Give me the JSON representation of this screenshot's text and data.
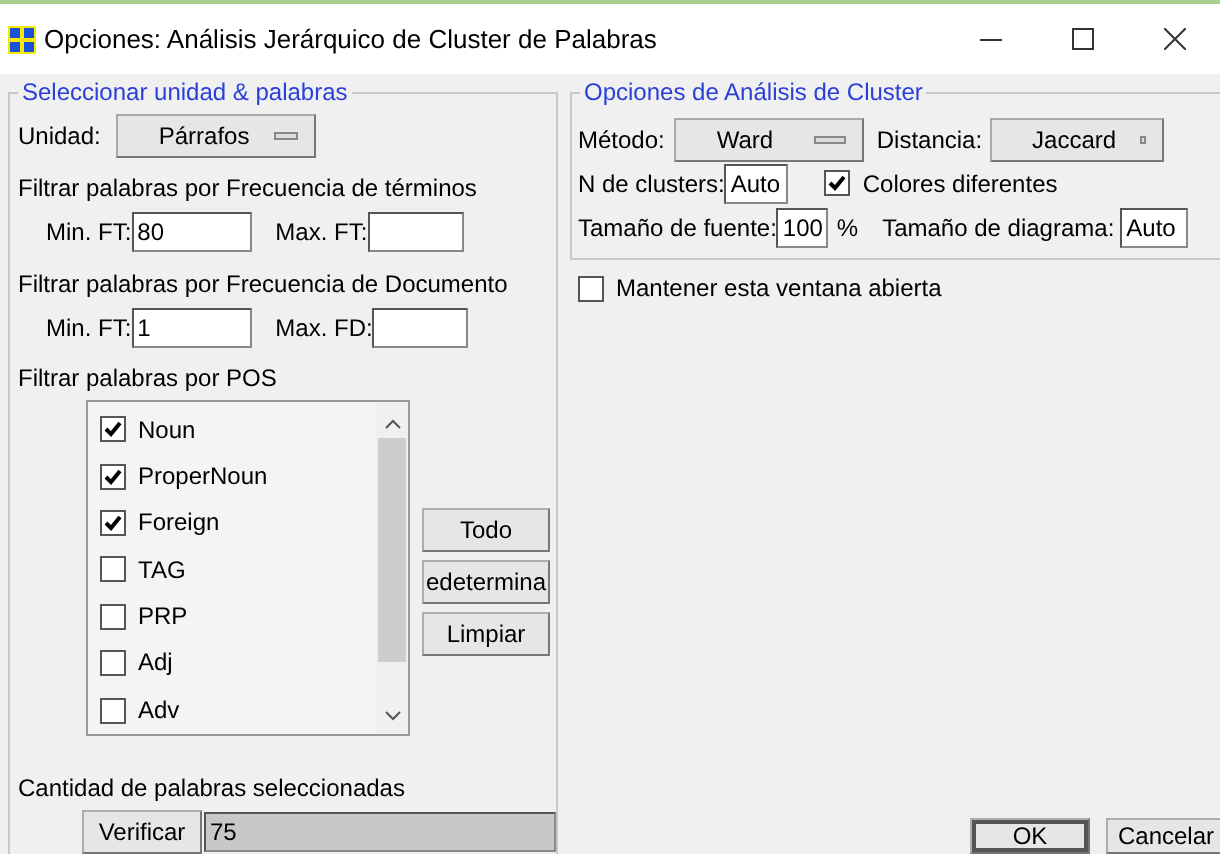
{
  "window": {
    "title": "Opciones: Análisis Jerárquico de Cluster de Palabras"
  },
  "unit_section": {
    "legend": "Seleccionar unidad & palabras",
    "unit_label": "Unidad:",
    "unit_value": "Párrafos",
    "term_filter": {
      "label": "Filtrar palabras por Frecuencia de términos",
      "min_label": "Min. FT:",
      "min_value": "80",
      "max_label": "Max. FT:"
    },
    "doc_filter": {
      "label": "Filtrar palabras por Frecuencia de Documento",
      "min_label": "Min. FT:",
      "min_value": "1",
      "max_label": "Max. FD:"
    },
    "pos_filter": {
      "label": "Filtrar palabras por POS",
      "items": [
        {
          "label": "Noun",
          "checked": true
        },
        {
          "label": "ProperNoun",
          "checked": true
        },
        {
          "label": "Foreign",
          "checked": true
        },
        {
          "label": "TAG",
          "checked": false
        },
        {
          "label": "PRP",
          "checked": false
        },
        {
          "label": "Adj",
          "checked": false
        },
        {
          "label": "Adv",
          "checked": false
        }
      ],
      "buttons": [
        "Todo",
        "edetermina",
        "Limpiar"
      ]
    },
    "count": {
      "label": "Cantidad de palabras seleccionadas",
      "button": "Verificar",
      "value": "75"
    }
  },
  "cluster_section": {
    "legend": "Opciones de Análisis de Cluster",
    "method_label": "Método:",
    "method_value": "Ward",
    "distance_label": "Distancia:",
    "distance_value": "Jaccard",
    "clusters_label": "N de clusters:",
    "clusters_value": "Auto",
    "colors": {
      "label": "Colores diferentes",
      "checked": true
    },
    "font_size_label": "Tamaño de fuente:",
    "font_size_value": "100",
    "font_size_unit": "%",
    "diagram_size_label": "Tamaño de diagrama:",
    "diagram_size_value": "Auto"
  },
  "keep_open": {
    "label": "Mantener esta ventana abierta",
    "checked": false
  },
  "buttons": [
    "OK",
    "Cancelar"
  ]
}
